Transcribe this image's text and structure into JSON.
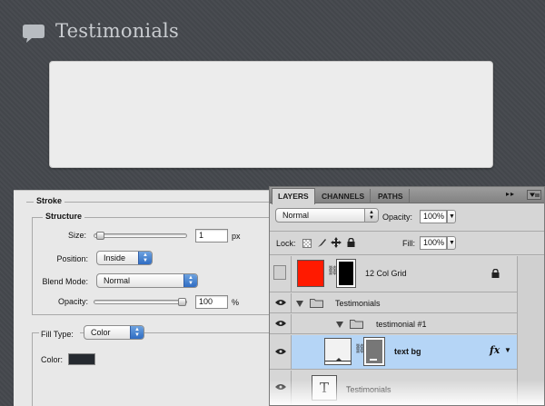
{
  "page": {
    "title": "Testimonials",
    "icon": "speech-bubble-icon"
  },
  "stroke": {
    "legend": "Stroke",
    "structure": {
      "legend": "Structure",
      "size_label": "Size:",
      "size_value": "1",
      "size_unit": "px",
      "size_level": 0.02,
      "position_label": "Position:",
      "position_value": "Inside",
      "blend_label": "Blend Mode:",
      "blend_value": "Normal",
      "opacity_label": "Opacity:",
      "opacity_value": "100",
      "opacity_unit": "%",
      "opacity_level": 1.0
    },
    "fill": {
      "type_label": "Fill Type:",
      "type_value": "Color",
      "color_label": "Color:",
      "color": "#252a30"
    }
  },
  "layers": {
    "tabs": [
      "LAYERS",
      "CHANNELS",
      "PATHS"
    ],
    "menu_glyphs": "▸▸",
    "blend_mode": "Normal",
    "opacity_label": "Opacity:",
    "opacity_value": "100%",
    "lock_label": "Lock:",
    "fill_label": "Fill:",
    "fill_value": "100%",
    "items": [
      {
        "name": "12 Col Grid",
        "type": "layer",
        "thumb_color": "#ff1a00",
        "locked": true
      },
      {
        "name": "Testimonials",
        "type": "group"
      },
      {
        "name": "testimonial #1",
        "type": "group"
      },
      {
        "name": "text bg",
        "type": "layer",
        "selected": true,
        "fx": "fx"
      },
      {
        "name": "Testimonials",
        "type": "text",
        "glyph": "T"
      }
    ],
    "selected_color": "#b5d5f6"
  }
}
